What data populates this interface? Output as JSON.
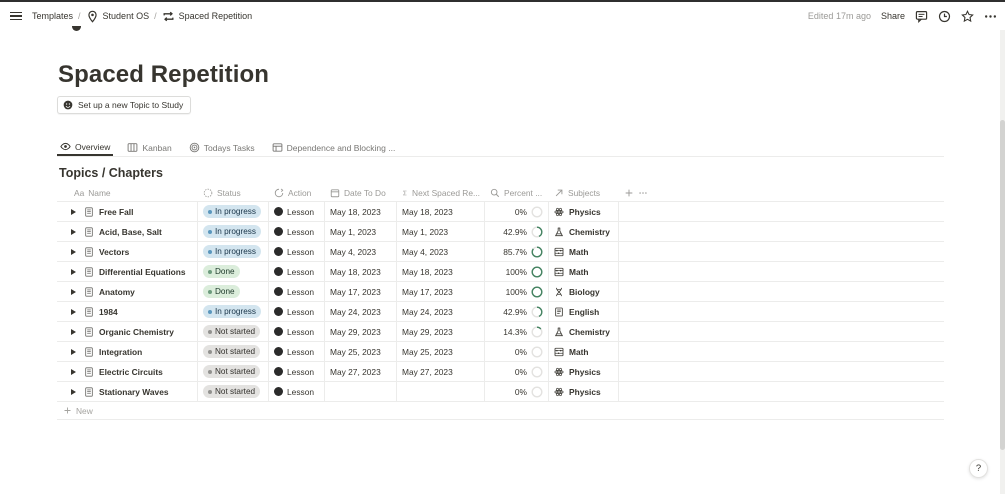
{
  "topbar": {
    "breadcrumbs": [
      "Templates",
      "Student OS",
      "Spaced Repetition"
    ],
    "separator": "/",
    "edited": "Edited 17m ago",
    "share": "Share"
  },
  "page": {
    "title": "Spaced Repetition",
    "setup_button": "Set up a new Topic to Study"
  },
  "tabs": [
    {
      "label": "Overview",
      "icon": "eye-icon",
      "active": true
    },
    {
      "label": "Kanban",
      "icon": "board-icon",
      "active": false
    },
    {
      "label": "Todays Tasks",
      "icon": "target-icon",
      "active": false
    },
    {
      "label": "Dependence and Blocking ...",
      "icon": "table-icon",
      "active": false
    }
  ],
  "database": {
    "title": "Topics / Chapters",
    "columns": {
      "name": "Name",
      "name_prefix": "Aa",
      "status": "Status",
      "action": "Action",
      "date": "Date To Do",
      "next": "Next Spaced Re...",
      "percent": "Percent ...",
      "subjects": "Subjects"
    },
    "rows": [
      {
        "name": "Free Fall",
        "status": "In progress",
        "status_key": "inprogress",
        "action": "Lesson",
        "date": "May 18, 2023",
        "next": "May 18, 2023",
        "percent": "0%",
        "pct_value": 0,
        "subject": "Physics",
        "subject_icon": "atom-icon"
      },
      {
        "name": "Acid, Base, Salt",
        "status": "In progress",
        "status_key": "inprogress",
        "action": "Lesson",
        "date": "May 1, 2023",
        "next": "May 1, 2023",
        "percent": "42.9%",
        "pct_value": 42.9,
        "subject": "Chemistry",
        "subject_icon": "flask-icon"
      },
      {
        "name": "Vectors",
        "status": "In progress",
        "status_key": "inprogress",
        "action": "Lesson",
        "date": "May 4, 2023",
        "next": "May 4, 2023",
        "percent": "85.7%",
        "pct_value": 85.7,
        "subject": "Math",
        "subject_icon": "abacus-icon"
      },
      {
        "name": "Differential Equations",
        "status": "Done",
        "status_key": "done",
        "action": "Lesson",
        "date": "May 18, 2023",
        "next": "May 18, 2023",
        "percent": "100%",
        "pct_value": 100,
        "subject": "Math",
        "subject_icon": "abacus-icon"
      },
      {
        "name": "Anatomy",
        "status": "Done",
        "status_key": "done",
        "action": "Lesson",
        "date": "May 17, 2023",
        "next": "May 17, 2023",
        "percent": "100%",
        "pct_value": 100,
        "subject": "Biology",
        "subject_icon": "dna-icon"
      },
      {
        "name": "1984",
        "status": "In progress",
        "status_key": "inprogress",
        "action": "Lesson",
        "date": "May 24, 2023",
        "next": "May 24, 2023",
        "percent": "42.9%",
        "pct_value": 42.9,
        "subject": "English",
        "subject_icon": "book-icon"
      },
      {
        "name": "Organic Chemistry",
        "status": "Not started",
        "status_key": "notstarted",
        "action": "Lesson",
        "date": "May 29, 2023",
        "next": "May 29, 2023",
        "percent": "14.3%",
        "pct_value": 14.3,
        "subject": "Chemistry",
        "subject_icon": "flask-icon"
      },
      {
        "name": "Integration",
        "status": "Not started",
        "status_key": "notstarted",
        "action": "Lesson",
        "date": "May 25, 2023",
        "next": "May 25, 2023",
        "percent": "0%",
        "pct_value": 0,
        "subject": "Math",
        "subject_icon": "abacus-icon"
      },
      {
        "name": "Electric Circuits",
        "status": "Not started",
        "status_key": "notstarted",
        "action": "Lesson",
        "date": "May 27, 2023",
        "next": "May 27, 2023",
        "percent": "0%",
        "pct_value": 0,
        "subject": "Physics",
        "subject_icon": "atom-icon"
      },
      {
        "name": "Stationary Waves",
        "status": "Not started",
        "status_key": "notstarted",
        "action": "Lesson",
        "date": "",
        "next": "",
        "percent": "0%",
        "pct_value": 0,
        "subject": "Physics",
        "subject_icon": "atom-icon"
      }
    ],
    "new_label": "New"
  },
  "help": "?",
  "colors": {
    "progress_ring": "#448361",
    "ring_track": "#e3e2e0"
  }
}
